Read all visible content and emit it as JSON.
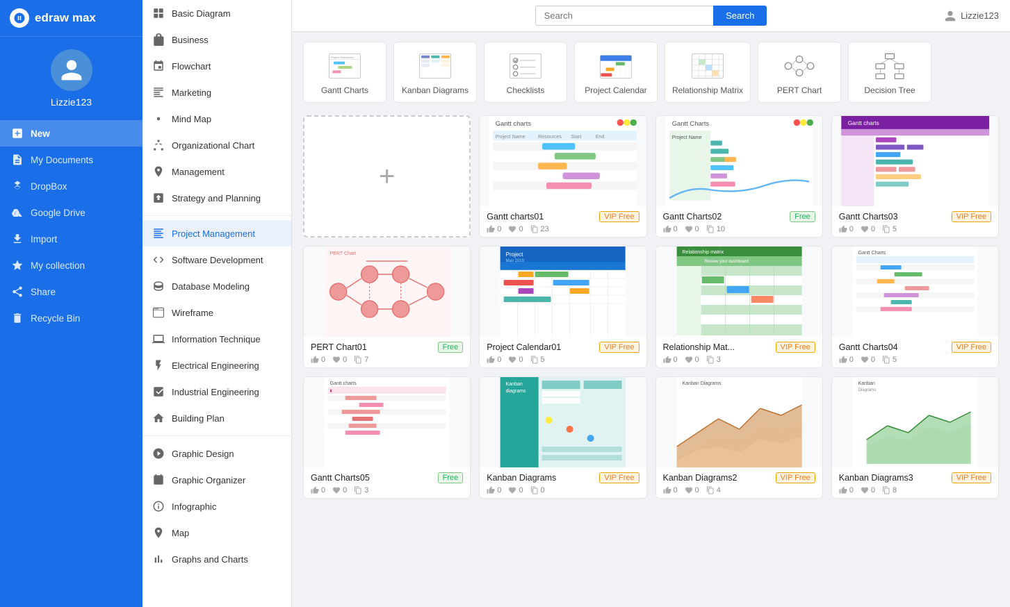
{
  "app": {
    "name": "edraw max",
    "username": "Lizzie123"
  },
  "search": {
    "placeholder": "Search",
    "button_label": "Search"
  },
  "nav": [
    {
      "id": "new",
      "label": "New",
      "active": true
    },
    {
      "id": "my-documents",
      "label": "My Documents",
      "active": false
    },
    {
      "id": "dropbox",
      "label": "DropBox",
      "active": false
    },
    {
      "id": "google-drive",
      "label": "Google Drive",
      "active": false
    },
    {
      "id": "import",
      "label": "Import",
      "active": false
    },
    {
      "id": "my-collection",
      "label": "My collection",
      "active": false
    },
    {
      "id": "share",
      "label": "Share",
      "active": false
    },
    {
      "id": "recycle-bin",
      "label": "Recycle Bin",
      "active": false
    }
  ],
  "categories": [
    {
      "id": "basic-diagram",
      "label": "Basic Diagram"
    },
    {
      "id": "business",
      "label": "Business"
    },
    {
      "id": "flowchart",
      "label": "Flowchart"
    },
    {
      "id": "marketing",
      "label": "Marketing"
    },
    {
      "id": "mind-map",
      "label": "Mind Map"
    },
    {
      "id": "org-chart",
      "label": "Organizational Chart"
    },
    {
      "id": "management",
      "label": "Management"
    },
    {
      "id": "strategy",
      "label": "Strategy and Planning"
    },
    {
      "id": "project-management",
      "label": "Project Management",
      "active": true
    },
    {
      "id": "software-dev",
      "label": "Software Development"
    },
    {
      "id": "database",
      "label": "Database Modeling"
    },
    {
      "id": "wireframe",
      "label": "Wireframe"
    },
    {
      "id": "info-tech",
      "label": "Information Technique"
    },
    {
      "id": "electrical",
      "label": "Electrical Engineering"
    },
    {
      "id": "industrial",
      "label": "Industrial Engineering"
    },
    {
      "id": "building",
      "label": "Building Plan"
    },
    {
      "id": "graphic-design",
      "label": "Graphic Design"
    },
    {
      "id": "graphic-organizer",
      "label": "Graphic Organizer"
    },
    {
      "id": "infographic",
      "label": "Infographic"
    },
    {
      "id": "map",
      "label": "Map"
    },
    {
      "id": "graphs",
      "label": "Graphs and Charts"
    }
  ],
  "shortcuts": [
    {
      "id": "gantt",
      "label": "Gantt Charts"
    },
    {
      "id": "kanban",
      "label": "Kanban Diagrams"
    },
    {
      "id": "checklist",
      "label": "Checklists"
    },
    {
      "id": "project-calendar",
      "label": "Project Calendar"
    },
    {
      "id": "relationship-matrix",
      "label": "Relationship Matrix"
    },
    {
      "id": "pert-chart",
      "label": "PERT Chart"
    },
    {
      "id": "decision-tree",
      "label": "Decision Tree"
    }
  ],
  "templates": [
    {
      "id": "new",
      "type": "new",
      "label": "New"
    },
    {
      "id": "gantt01",
      "title": "Gantt charts01",
      "badge": "VIP Free",
      "badge_type": "vip",
      "likes": 0,
      "hearts": 0,
      "copies": 23,
      "preview_type": "gantt1"
    },
    {
      "id": "gantt02",
      "title": "Gantt Charts02",
      "badge": "Free",
      "badge_type": "free",
      "likes": 0,
      "hearts": 0,
      "copies": 10,
      "preview_type": "gantt2"
    },
    {
      "id": "gantt03",
      "title": "Gantt Charts03",
      "badge": "VIP Free",
      "badge_type": "vip",
      "likes": 0,
      "hearts": 0,
      "copies": 5,
      "preview_type": "gantt3"
    },
    {
      "id": "pert01",
      "title": "PERT Chart01",
      "badge": "Free",
      "badge_type": "free",
      "likes": 0,
      "hearts": 0,
      "copies": 7,
      "preview_type": "pert"
    },
    {
      "id": "project-cal01",
      "title": "Project Calendar01",
      "badge": "VIP Free",
      "badge_type": "vip",
      "likes": 0,
      "hearts": 0,
      "copies": 5,
      "preview_type": "projectcal"
    },
    {
      "id": "rel-mat01",
      "title": "Relationship Mat...",
      "badge": "VIP Free",
      "badge_type": "vip",
      "likes": 0,
      "hearts": 0,
      "copies": 3,
      "preview_type": "relmatrix"
    },
    {
      "id": "gantt04",
      "title": "Gantt Charts04",
      "badge": "VIP Free",
      "badge_type": "vip",
      "likes": 0,
      "hearts": 0,
      "copies": 5,
      "preview_type": "gantt4"
    },
    {
      "id": "gantt05",
      "title": "Gantt Charts05",
      "badge": "Free",
      "badge_type": "free",
      "likes": 0,
      "hearts": 0,
      "copies": 3,
      "preview_type": "gantt5"
    },
    {
      "id": "kanban01",
      "title": "Kanban Diagrams",
      "badge": "VIP Free",
      "badge_type": "vip",
      "likes": 0,
      "hearts": 0,
      "copies": 0,
      "preview_type": "kanban1"
    },
    {
      "id": "kanban02",
      "title": "Kanban Diagrams2",
      "badge": "VIP Free",
      "badge_type": "vip",
      "likes": 0,
      "hearts": 0,
      "copies": 4,
      "preview_type": "kanban2"
    },
    {
      "id": "kanban03",
      "title": "Kanban Diagrams3",
      "badge": "VIP Free",
      "badge_type": "vip",
      "likes": 0,
      "hearts": 0,
      "copies": 8,
      "preview_type": "kanban3"
    }
  ]
}
